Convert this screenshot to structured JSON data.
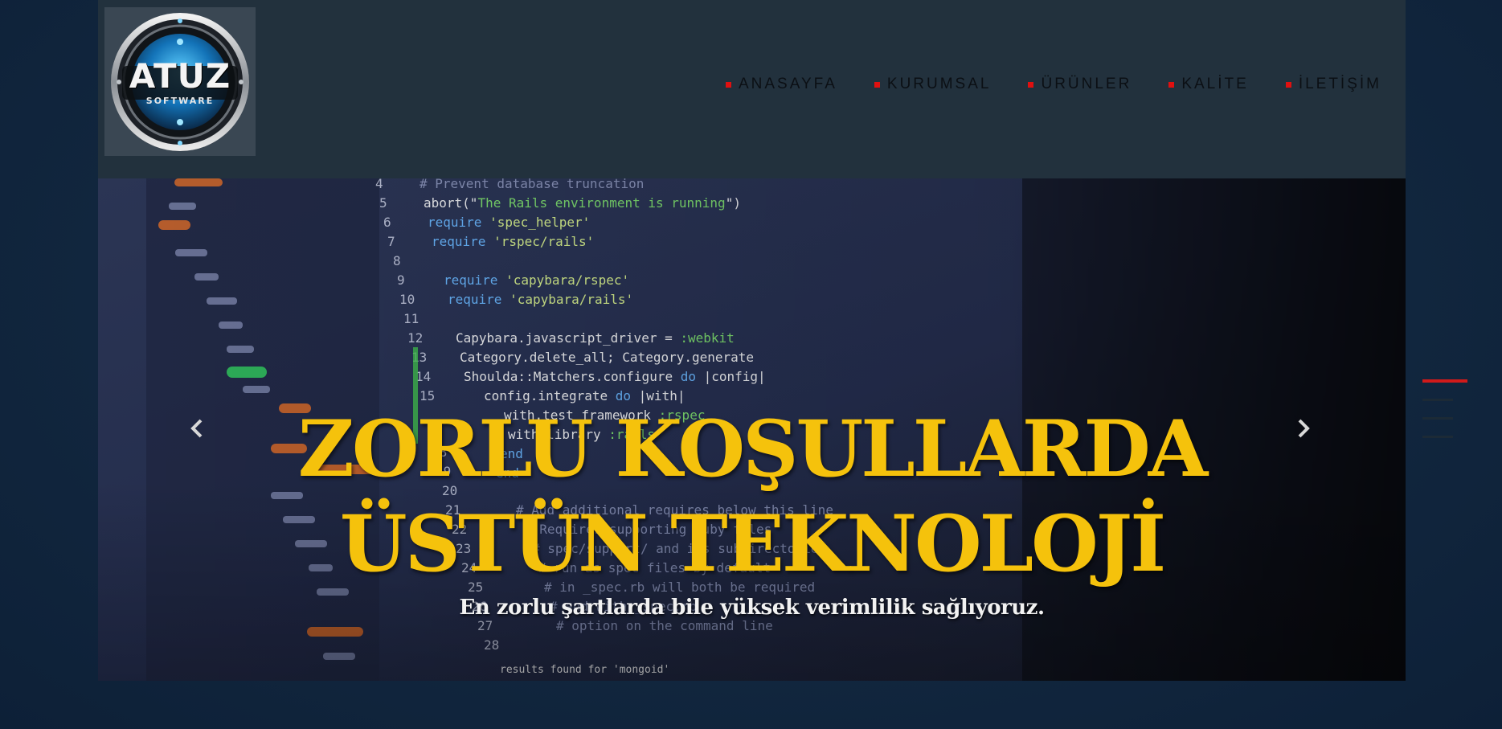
{
  "logo": {
    "brand": "ATUZ",
    "tagline": "SOFTWARE"
  },
  "nav": {
    "items": [
      {
        "label": "ANASAYFA"
      },
      {
        "label": "KURUMSAL"
      },
      {
        "label": "ÜRÜNLER"
      },
      {
        "label": "KALİTE"
      },
      {
        "label": "İLETİŞİM"
      }
    ]
  },
  "hero": {
    "title_line1": "ZORLU KOŞULLARDA",
    "title_line2": "ÜSTÜN TEKNOLOJİ",
    "subtitle": "En zorlu şartlarda bile yüksek verimlilik sağlıyoruz.",
    "prev_icon": "chevron-left-icon",
    "next_icon": "chevron-right-icon"
  },
  "slider": {
    "active_index": 0,
    "count": 4
  },
  "colors": {
    "accent": "#f5c20c",
    "bullet": "#e01010",
    "header_bg": "#22313d",
    "page_bg": "#12273f"
  }
}
